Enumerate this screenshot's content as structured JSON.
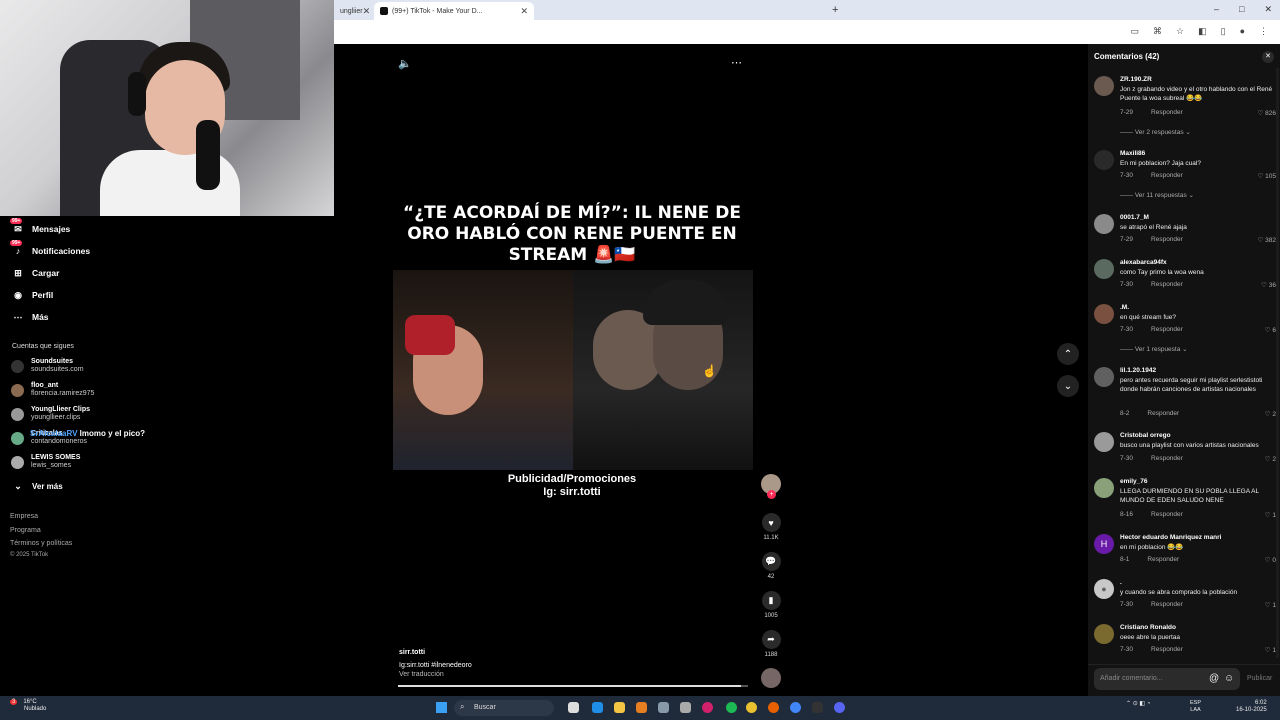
{
  "browser": {
    "tabs": [
      {
        "label": "ungliier"
      },
      {
        "label": "(99+) TikTok - Make Your D..."
      }
    ]
  },
  "sidebar": {
    "nav": [
      {
        "label": "Mensajes",
        "icon": "message-icon",
        "badge": "99+"
      },
      {
        "label": "Notificaciones",
        "icon": "bell-icon",
        "badge": "99+"
      },
      {
        "label": "Cargar",
        "icon": "upload-icon"
      },
      {
        "label": "Perfil",
        "icon": "profile-icon"
      },
      {
        "label": "Más",
        "icon": "more-icon"
      }
    ],
    "following_title": "Cuentas que sigues",
    "following": [
      {
        "name": "Soundsuites",
        "handle": "soundsuites.com"
      },
      {
        "name": "floo_ant",
        "handle": "florencia.ramirez975"
      },
      {
        "name": "YoungLlieer Clips",
        "handle": "youngllieer.clips"
      },
      {
        "name": "Criticalas",
        "handle": "contandomoneros"
      },
      {
        "name": "LEWIS SOMES",
        "handle": "lewis_somes"
      }
    ],
    "see_more": "Ver más",
    "footer": [
      "Empresa",
      "Programa",
      "Términos y políticas",
      "© 2025 TikTok"
    ]
  },
  "overlay_chat": {
    "user": "SrAIcalaaRV",
    "message": "lmomo y el pico?"
  },
  "video": {
    "headline": "“¿TE ACORDAÍ DE MÍ?”: IL NENE DE ORO HABLÓ CON RENE PUENTE EN STREAM 🚨🇨🇱",
    "promo_line1": "Publicidad/Promociones",
    "promo_line2": "Ig: sirr.totti",
    "author": "sirr.totti",
    "caption": "Ig:sirr.totti #ilnenedeoro",
    "translate": "Ver traducción",
    "progress": 0.98,
    "actions": [
      {
        "name": "like",
        "icon": "heart-icon",
        "count": "11.1K"
      },
      {
        "name": "comment",
        "icon": "comment-icon",
        "count": "42"
      },
      {
        "name": "save",
        "icon": "bookmark-icon",
        "count": "1005"
      },
      {
        "name": "share",
        "icon": "share-icon",
        "count": "1188"
      }
    ]
  },
  "comments": {
    "title": "Comentarios (42)",
    "items": [
      {
        "user": "ZR.190.ZR",
        "text": "Jon z grabando video y el otro hablando con el René Puente la woa subreal 😂😂",
        "date": "7-29",
        "reply": "Responder",
        "likes": "826",
        "more": "Ver 2 respuestas"
      },
      {
        "user": "Maxili86",
        "text": "En mi poblacion? Jaja cual?",
        "date": "7-30",
        "reply": "Responder",
        "likes": "105",
        "more": "Ver 11 respuestas"
      },
      {
        "user": "0001.7_M",
        "text": "se atrapó el René ajaja",
        "date": "7-29",
        "reply": "Responder",
        "likes": "382",
        "more": ""
      },
      {
        "user": "alexabarca94fx",
        "text": "como Tay primo la woa wena",
        "date": "7-30",
        "reply": "Responder",
        "likes": "36",
        "more": ""
      },
      {
        "user": ".M.",
        "text": "en qué stream fue?",
        "date": "7-30",
        "reply": "Responder",
        "likes": "6",
        "more": "Ver 1 respuesta"
      },
      {
        "user": "lil.1.20.1942",
        "text": "pero antes recuerda seguir mi playlist serlestistoti donde habrán canciones de artistas nacionales",
        "date": "8-2",
        "reply": "Responder",
        "likes": "2",
        "more": ""
      },
      {
        "user": "Cristobal orrego",
        "text": "busco una playlist con varios artistas nacionales",
        "date": "7-30",
        "reply": "Responder",
        "likes": "2",
        "more": ""
      },
      {
        "user": "emily_76",
        "text": "LLEGA DURMIENDO EN SU POBLA LLEGA AL MUNDO DE EDEN SALUDO NENE",
        "date": "8-16",
        "reply": "Responder",
        "likes": "1",
        "more": ""
      },
      {
        "user": "Hector eduardo Manriquez manri",
        "text": "en mi poblacion 😂😂",
        "date": "8-1",
        "reply": "Responder",
        "likes": "0",
        "more": "",
        "avatar_letter": "H"
      },
      {
        "user": ".",
        "text": "y cuando se abra comprado la población",
        "date": "7-30",
        "reply": "Responder",
        "likes": "1",
        "more": ""
      },
      {
        "user": "Cristiano Ronaldo",
        "text": "oeee abre la puertaa",
        "date": "7-30",
        "reply": "Responder",
        "likes": "1",
        "more": ""
      }
    ],
    "input_placeholder": "Añadir comentario...",
    "publish": "Publicar"
  },
  "taskbar": {
    "weather_temp": "16°C",
    "weather_desc": "Nublado",
    "weather_alert": "3",
    "search": "Buscar",
    "lang1": "ESP",
    "lang2": "LAA",
    "time": "6:02",
    "date": "16-10-2025"
  },
  "colors": {
    "accent": "#fe2c55",
    "panel": "#121212",
    "chrome": "#dfe6f1"
  }
}
